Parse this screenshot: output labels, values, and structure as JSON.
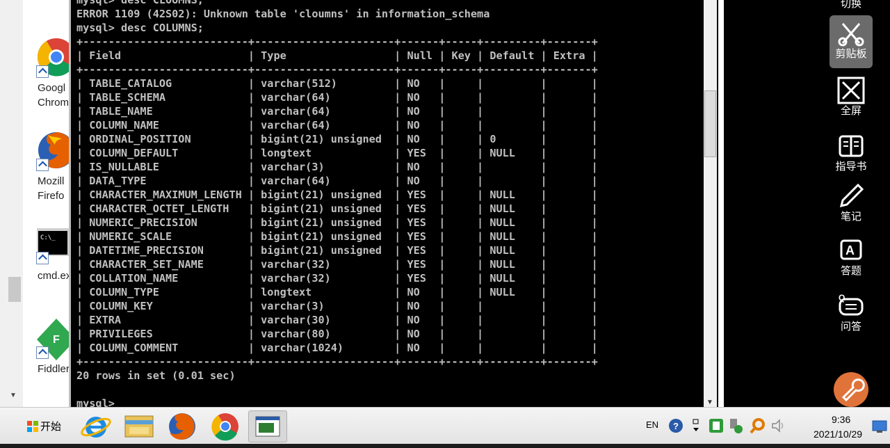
{
  "console": {
    "lines": [
      "mysql> desc CLOUMNS;",
      "ERROR 1109 (42S02): Unknown table 'cloumns' in information_schema",
      "mysql> desc COLUMNS;",
      "+--------------------------+----------------------+------+-----+---------+-------+",
      "| Field                    | Type                 | Null | Key | Default | Extra |",
      "+--------------------------+----------------------+------+-----+---------+-------+",
      "| TABLE_CATALOG            | varchar(512)         | NO   |     |         |       |",
      "| TABLE_SCHEMA             | varchar(64)          | NO   |     |         |       |",
      "| TABLE_NAME               | varchar(64)          | NO   |     |         |       |",
      "| COLUMN_NAME              | varchar(64)          | NO   |     |         |       |",
      "| ORDINAL_POSITION         | bigint(21) unsigned  | NO   |     | 0       |       |",
      "| COLUMN_DEFAULT           | longtext             | YES  |     | NULL    |       |",
      "| IS_NULLABLE              | varchar(3)           | NO   |     |         |       |",
      "| DATA_TYPE                | varchar(64)          | NO   |     |         |       |",
      "| CHARACTER_MAXIMUM_LENGTH | bigint(21) unsigned  | YES  |     | NULL    |       |",
      "| CHARACTER_OCTET_LENGTH   | bigint(21) unsigned  | YES  |     | NULL    |       |",
      "| NUMERIC_PRECISION        | bigint(21) unsigned  | YES  |     | NULL    |       |",
      "| NUMERIC_SCALE            | bigint(21) unsigned  | YES  |     | NULL    |       |",
      "| DATETIME_PRECISION       | bigint(21) unsigned  | YES  |     | NULL    |       |",
      "| CHARACTER_SET_NAME       | varchar(32)          | YES  |     | NULL    |       |",
      "| COLLATION_NAME           | varchar(32)          | YES  |     | NULL    |       |",
      "| COLUMN_TYPE              | longtext             | NO   |     | NULL    |       |",
      "| COLUMN_KEY               | varchar(3)           | NO   |     |         |       |",
      "| EXTRA                    | varchar(30)          | NO   |     |         |       |",
      "| PRIVILEGES               | varchar(80)          | NO   |     |         |       |",
      "| COLUMN_COMMENT           | varchar(1024)        | NO   |     |         |       |",
      "+--------------------------+----------------------+------+-----+---------+-------+",
      "20 rows in set (0.01 sec)",
      "",
      "mysql>"
    ]
  },
  "desktop": {
    "icons": [
      {
        "label": "Googl\nChrom",
        "icon": "chrome-icon"
      },
      {
        "label": "Mozill\nFirefo",
        "icon": "firefox-icon"
      },
      {
        "label": "cmd.ex",
        "icon": "cmd-icon"
      },
      {
        "label": "Fiddler",
        "icon": "fiddler-icon"
      }
    ]
  },
  "toolbar": {
    "switch_label": "切换",
    "clipboard_label": "剪贴板",
    "fullscreen_label": "全屏",
    "guide_label": "指导书",
    "notes_label": "笔记",
    "answer_label": "答题",
    "qa_label": "问答"
  },
  "taskbar": {
    "start_label": "开始",
    "lang": "EN",
    "time": "9:36",
    "date": "2021/10/29"
  },
  "colors": {
    "console_text": "#c0c0c0",
    "console_bg": "#000000",
    "toolbar_bg": "#000000",
    "fab": "#e0733a"
  }
}
